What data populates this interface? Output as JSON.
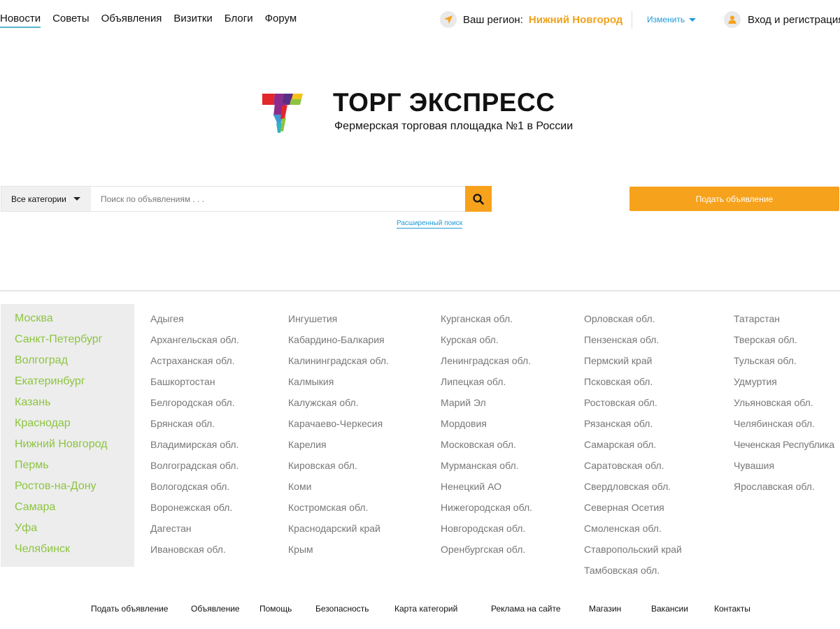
{
  "nav": {
    "items": [
      {
        "label": "Новости",
        "active": true
      },
      {
        "label": "Советы"
      },
      {
        "label": "Объявления"
      },
      {
        "label": "Визитки"
      },
      {
        "label": "Блоги"
      },
      {
        "label": "Форум"
      }
    ]
  },
  "region": {
    "label": "Ваш регион:",
    "value": "Нижний Новгород",
    "change": "Изменить"
  },
  "login": {
    "label": "Вход и регистрация"
  },
  "brand": {
    "title": "ТОРГ ЭКСПРЕСС",
    "subtitle": "Фермерская торговая площадка №1 в России"
  },
  "search": {
    "category": "Все категории",
    "placeholder": "Поиск по объявлениям . . .",
    "advanced": "Расширенный поиск",
    "post_ad": "Подать объявление"
  },
  "cities": [
    "Москва",
    "Санкт-Петербург",
    "Волгоград",
    "Екатеринбург",
    "Казань",
    "Краснодар",
    "Нижний Новгород",
    "Пермь",
    "Ростов-на-Дону",
    "Самара",
    "Уфа",
    "Челябинск"
  ],
  "region_columns": [
    [
      "Адыгея",
      "Архангельская обл.",
      "Астраханская обл.",
      "Башкортостан",
      "Белгородская обл.",
      "Брянская обл.",
      "Владимирская обл.",
      "Волгоградская обл.",
      "Вологодская обл.",
      "Воронежская обл.",
      "Дагестан",
      "Ивановская обл."
    ],
    [
      "Ингушетия",
      "Кабардино-Балкария",
      "Калининградская обл.",
      "Калмыкия",
      "Калужская обл.",
      "Карачаево-Черкесия",
      "Карелия",
      "Кировская обл.",
      "Коми",
      "Костромская обл.",
      "Краснодарский край",
      "Крым"
    ],
    [
      "Курганская обл.",
      "Курская обл.",
      "Ленинградская обл.",
      "Липецкая обл.",
      "Марий Эл",
      "Мордовия",
      "Московская обл.",
      "Мурманская обл.",
      "Ненецкий АО",
      "Нижегородская обл.",
      "Новгородская обл.",
      "Оренбургская обл."
    ],
    [
      "Орловская обл.",
      "Пензенская обл.",
      "Пермский край",
      "Псковская обл.",
      "Ростовская обл.",
      "Рязанская обл.",
      "Самарская обл.",
      "Саратовская обл.",
      "Свердловская обл.",
      "Северная Осетия",
      "Смоленская обл.",
      "Ставропольский край",
      "Тамбовская обл."
    ],
    [
      "Татарстан",
      "Тверская обл.",
      "Тульская обл.",
      "Удмуртия",
      "Ульяновская обл.",
      "Челябинская обл.",
      "Чеченская Республика",
      "Чувашия",
      "Ярославская обл."
    ]
  ],
  "footer": [
    "Подать объявление",
    "Объявление",
    "Помощь",
    "Безопасность",
    "Карта категорий",
    "Реклама на сайте",
    "Магазин",
    "Вакансии",
    "Контакты"
  ],
  "colors": {
    "accent": "#f7a21c",
    "region_value": "#f0a21c",
    "link_blue": "#1e9ad6",
    "city_green": "#8cc43f"
  }
}
